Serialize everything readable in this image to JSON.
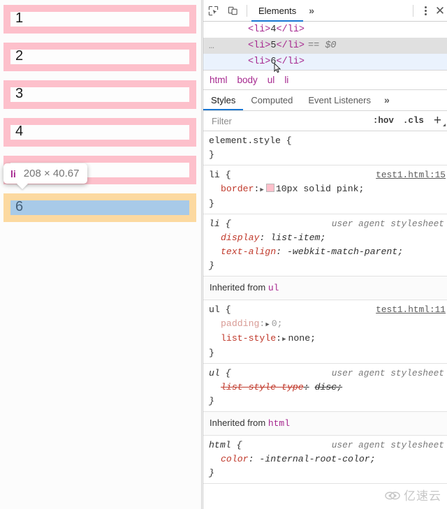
{
  "page": {
    "list_items": [
      {
        "text": "1",
        "state": "normal"
      },
      {
        "text": "2",
        "state": "normal"
      },
      {
        "text": "3",
        "state": "normal"
      },
      {
        "text": "4",
        "state": "normal"
      },
      {
        "text": "5",
        "state": "normal"
      },
      {
        "text": "6",
        "state": "highlighted"
      }
    ],
    "border_color": "#fdc0cb",
    "highlight_padding_color": "#fcd9a0",
    "highlight_content_color": "#a8cae8"
  },
  "inspector_tooltip": {
    "tag": "li",
    "dimensions": "208 × 40.67"
  },
  "devtools": {
    "toolbar": {
      "inspect_title": "Inspect",
      "device_title": "Toggle device toolbar",
      "tabs": [
        {
          "label": "Elements",
          "active": true
        }
      ],
      "more_tabs": "»",
      "menu": "⋮",
      "close": "✕"
    },
    "dom_tree": {
      "rows": [
        {
          "prefix": "",
          "open": "<li>",
          "text": "4",
          "close": "</li>",
          "suffix": "",
          "state": "normal"
        },
        {
          "prefix": "…",
          "open": "<li>",
          "text": "5",
          "close": "</li>",
          "suffix": "== $0",
          "state": "selected"
        },
        {
          "prefix": "",
          "open": "<li>",
          "text": "6",
          "close": "</li>",
          "suffix": "",
          "state": "hovered"
        }
      ]
    },
    "breadcrumb": [
      "html",
      "body",
      "ul",
      "li"
    ],
    "styles_tabs": [
      {
        "label": "Styles",
        "active": true
      },
      {
        "label": "Computed",
        "active": false
      },
      {
        "label": "Event Listeners",
        "active": false
      }
    ],
    "styles_more": "»",
    "filter_bar": {
      "placeholder": "Filter",
      "value": "",
      "hov": ":hov",
      "cls": ".cls",
      "plus": "+"
    },
    "rules": [
      {
        "selector": "element.style {",
        "origin": "",
        "origin_type": "none",
        "ua": false,
        "declarations": [],
        "close": "}"
      },
      {
        "selector": "li {",
        "origin": "test1.html:15",
        "origin_type": "link",
        "ua": false,
        "declarations": [
          {
            "prop": "border",
            "value": "10px solid pink;",
            "expandable": true,
            "swatch": "#ffc0cb",
            "inactive": false,
            "strike": false
          }
        ],
        "close": "}"
      },
      {
        "selector": "li {",
        "origin": "user agent stylesheet",
        "origin_type": "ua",
        "ua": true,
        "declarations": [
          {
            "prop": "display",
            "value": "list-item;",
            "expandable": false,
            "swatch": "",
            "inactive": false,
            "strike": false
          },
          {
            "prop": "text-align",
            "value": "-webkit-match-parent;",
            "expandable": false,
            "swatch": "",
            "inactive": false,
            "strike": false
          }
        ],
        "close": "}"
      },
      {
        "inherited_from": "Inherited from",
        "inherited_tag": "ul"
      },
      {
        "selector": "ul {",
        "origin": "test1.html:11",
        "origin_type": "link",
        "ua": false,
        "declarations": [
          {
            "prop": "padding",
            "value": "0;",
            "expandable": true,
            "swatch": "",
            "inactive": true,
            "strike": false
          },
          {
            "prop": "list-style",
            "value": "none;",
            "expandable": true,
            "swatch": "",
            "inactive": false,
            "strike": false
          }
        ],
        "close": "}"
      },
      {
        "selector": "ul {",
        "origin": "user agent stylesheet",
        "origin_type": "ua",
        "ua": true,
        "declarations": [
          {
            "prop": "list-style-type",
            "value": "disc;",
            "expandable": false,
            "swatch": "",
            "inactive": false,
            "strike": true
          }
        ],
        "close": "}"
      },
      {
        "inherited_from": "Inherited from",
        "inherited_tag": "html"
      },
      {
        "selector": "html {",
        "origin": "user agent stylesheet",
        "origin_type": "ua",
        "ua": true,
        "declarations": [
          {
            "prop": "color",
            "value": "-internal-root-color;",
            "expandable": false,
            "swatch": "",
            "inactive": false,
            "strike": false
          }
        ],
        "close": "}"
      }
    ]
  },
  "watermark": {
    "text": "亿速云"
  }
}
